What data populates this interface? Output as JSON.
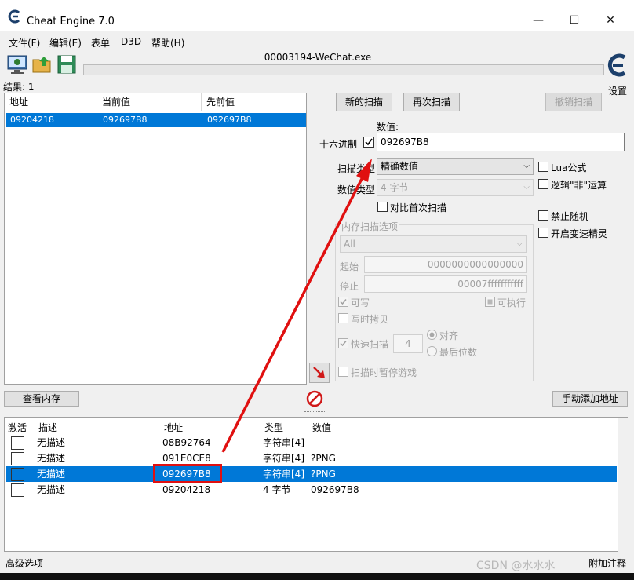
{
  "window": {
    "title": "Cheat Engine 7.0",
    "minimize_icon": "—",
    "maximize_icon": "☐",
    "close_icon": "✕"
  },
  "menu": [
    "文件(F)",
    "编辑(E)",
    "表单",
    "D3D",
    "帮助(H)"
  ],
  "toolbar": {
    "process_name": "00003194-WeChat.exe",
    "settings_label": "设置"
  },
  "results": {
    "count_label": "结果: 1",
    "columns": [
      "地址",
      "当前值",
      "先前值"
    ],
    "rows": [
      {
        "address": "09204218",
        "current": "092697B8",
        "previous": "092697B8"
      }
    ]
  },
  "scan": {
    "new_scan": "新的扫描",
    "next_scan": "再次扫描",
    "undo_scan": "撤销扫描",
    "value_label": "数值:",
    "hex_label": "十六进制",
    "value": "092697B8",
    "scan_type_label": "扫描类型",
    "scan_type": "精确数值",
    "value_type_label": "数值类型",
    "value_type": "4 字节",
    "compare_first": "对比首次扫描",
    "lua": "Lua公式",
    "not_logic": "逻辑\"非\"运算",
    "no_random": "禁止随机",
    "speedhack": "开启变速精灵",
    "memory": {
      "title": "内存扫描选项",
      "region": "All",
      "start_label": "起始",
      "start": "0000000000000000",
      "stop_label": "停止",
      "stop": "00007fffffffffff",
      "writable": "可写",
      "executable": "可执行",
      "copy_on_write": "写时拷贝",
      "fast_scan": "快速扫描",
      "fast_value": "4",
      "align": "对齐",
      "last_digits": "最后位数",
      "pause": "扫描时暂停游戏"
    }
  },
  "buttons": {
    "view_memory": "查看内存",
    "add_address": "手动添加地址"
  },
  "table": {
    "columns": [
      "激活",
      "描述",
      "地址",
      "类型",
      "数值"
    ],
    "rows": [
      {
        "desc": "无描述",
        "address": "08B92764",
        "type": "字符串[4]",
        "value": ""
      },
      {
        "desc": "无描述",
        "address": "091E0CE8",
        "type": "字符串[4]",
        "value": "?PNG"
      },
      {
        "desc": "无描述",
        "address": "092697B8",
        "type": "字符串[4]",
        "value": "?PNG"
      },
      {
        "desc": "无描述",
        "address": "09204218",
        "type": "4 字节",
        "value": "092697B8"
      }
    ]
  },
  "status": {
    "left": "高级选项",
    "right": "附加注释"
  },
  "watermark": "CSDN @水水水",
  "colors": {
    "selection": "#0078d7",
    "annotation": "#e01010"
  }
}
